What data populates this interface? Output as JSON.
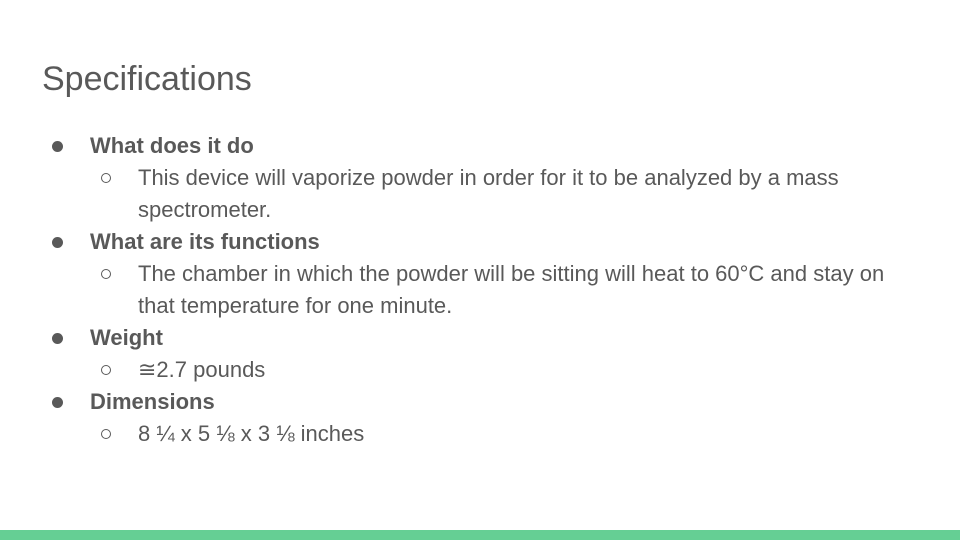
{
  "slide": {
    "title": "Specifications",
    "accent_color": "#65cf94",
    "text_color": "#595959",
    "bullets": [
      {
        "heading": "What does it do",
        "detail": "This device will vaporize powder in order for it to be analyzed by a mass spectrometer."
      },
      {
        "heading": "What are its functions",
        "detail": "The chamber in which the powder will be sitting will heat to 60°C and stay on that temperature for one minute."
      },
      {
        "heading": "Weight",
        "detail": "≅2.7 pounds"
      },
      {
        "heading": "Dimensions",
        "detail": "8 ¼ x 5 ⅛ x 3 ⅛ inches"
      }
    ]
  }
}
